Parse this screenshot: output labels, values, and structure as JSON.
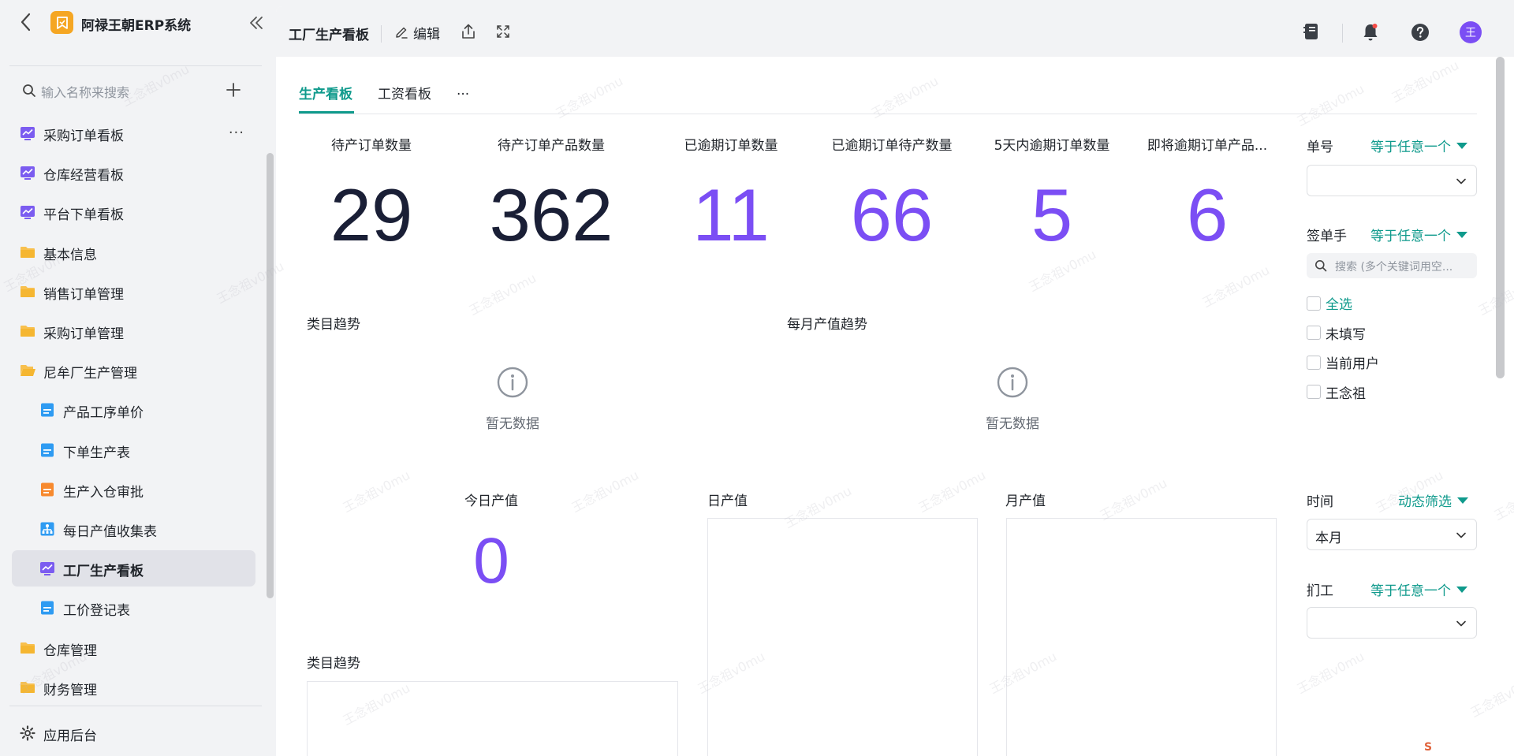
{
  "app": {
    "title": "阿禄王朝ERP系统",
    "search_placeholder": "输入名称来搜索",
    "footer_label": "应用后台"
  },
  "sidebar": {
    "items": [
      {
        "label": "采购订单看板",
        "icon": "chart-board-icon",
        "level": 0,
        "active": false,
        "has_more": true
      },
      {
        "label": "仓库经营看板",
        "icon": "chart-board-icon",
        "level": 0,
        "active": false
      },
      {
        "label": "平台下单看板",
        "icon": "chart-board-icon",
        "level": 0,
        "active": false
      },
      {
        "label": "基本信息",
        "icon": "folder-icon",
        "level": 0,
        "active": false
      },
      {
        "label": "销售订单管理",
        "icon": "folder-icon",
        "level": 0,
        "active": false
      },
      {
        "label": "采购订单管理",
        "icon": "folder-icon",
        "level": 0,
        "active": false
      },
      {
        "label": "尼牟厂生产管理",
        "icon": "folder-open-icon",
        "level": 0,
        "active": false
      },
      {
        "label": "产品工序单价",
        "icon": "form-icon",
        "level": 1,
        "active": false
      },
      {
        "label": "下单生产表",
        "icon": "form-icon",
        "level": 1,
        "active": false
      },
      {
        "label": "生产入仓审批",
        "icon": "approval-form-icon",
        "level": 1,
        "active": false
      },
      {
        "label": "每日产值收集表",
        "icon": "collection-icon",
        "level": 1,
        "active": false
      },
      {
        "label": "工厂生产看板",
        "icon": "chart-board-icon",
        "level": 1,
        "active": true
      },
      {
        "label": "工价登记表",
        "icon": "form-icon",
        "level": 1,
        "active": false
      },
      {
        "label": "仓库管理",
        "icon": "folder-icon",
        "level": 0,
        "active": false
      },
      {
        "label": "财务管理",
        "icon": "folder-icon",
        "level": 0,
        "active": false
      }
    ]
  },
  "header": {
    "page_title": "工厂生产看板",
    "edit_label": "编辑",
    "avatar_text": "王"
  },
  "tabs": [
    {
      "label": "生产看板",
      "active": true
    },
    {
      "label": "工资看板",
      "active": false
    },
    {
      "label": "...",
      "active": false
    }
  ],
  "kpis": [
    {
      "label": "待产订单数量",
      "value": "29",
      "style": "dark"
    },
    {
      "label": "待产订单产品数量",
      "value": "362",
      "style": "dark"
    },
    {
      "label": "已逾期订单数量",
      "value": "11",
      "style": "purple"
    },
    {
      "label": "已逾期订单待产数量",
      "value": "66",
      "style": "purple"
    },
    {
      "label": "5天内逾期订单数量",
      "value": "5",
      "style": "purple"
    },
    {
      "label": "即将逾期订单产品...",
      "value": "6",
      "style": "purple"
    }
  ],
  "charts": {
    "category_trend_title": "类目趋势",
    "monthly_output_trend_title": "每月产值趋势",
    "empty_text": "暂无数据",
    "today_output_label": "今日产值",
    "today_output_value": "0",
    "daily_output_title": "日产值",
    "monthly_output_title": "月产值",
    "category_trend_title_2": "类目趋势"
  },
  "filters": {
    "order_no": {
      "label": "单号",
      "operator": "等于任意一个",
      "value": ""
    },
    "signer": {
      "label": "签单手",
      "operator": "等于任意一个",
      "search_placeholder": "搜索 (多个关键词用空...",
      "options": [
        "全选",
        "未填写",
        "当前用户",
        "王念祖"
      ]
    },
    "time": {
      "label": "时间",
      "operator": "动态筛选",
      "value": "本月"
    },
    "worker": {
      "label": "扪工",
      "operator": "等于任意一个",
      "value": ""
    }
  },
  "watermark": "王念祖v0mu",
  "colors": {
    "accent": "#0f9a8c",
    "purple": "#7b4ef4",
    "dark_number": "#1a1f36",
    "logo": "#f5a623"
  }
}
